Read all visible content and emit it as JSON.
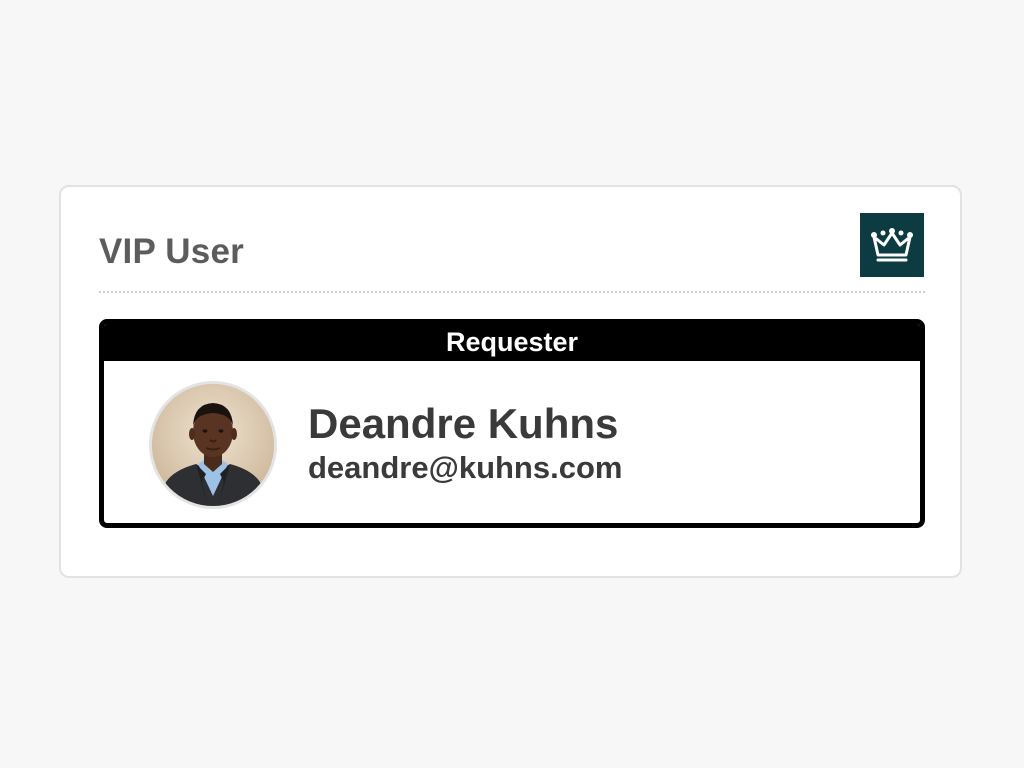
{
  "card": {
    "title": "VIP User",
    "badge_icon": "crown-icon"
  },
  "requester": {
    "header": "Requester",
    "name": "Deandre Kuhns",
    "email": "deandre@kuhns.com",
    "avatar": "user-photo"
  },
  "colors": {
    "badge_background": "#0d3b42",
    "header_background": "#000000",
    "text_primary": "#3a3a3a",
    "title_text": "#5c5c5c"
  }
}
